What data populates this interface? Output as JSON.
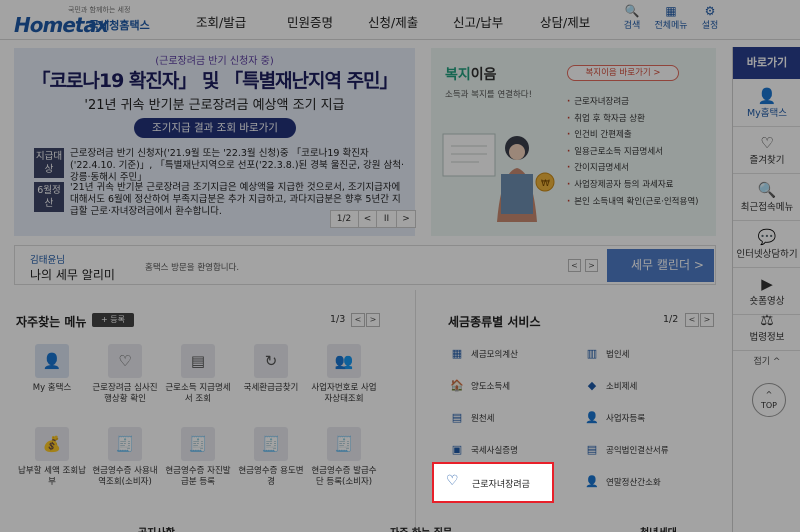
{
  "header": {
    "logo_small": "국민과 함께하는 세정",
    "logo_main": "Hometax",
    "logo_sub": "국세청홈택스",
    "nav": [
      "조회/발급",
      "민원증명",
      "신청/제출",
      "신고/납부",
      "상담/제보"
    ],
    "icons": [
      {
        "label": "검색",
        "glyph": "🔍",
        "icon": "search-icon"
      },
      {
        "label": "전체메뉴",
        "glyph": "▦",
        "icon": "grid-icon"
      },
      {
        "label": "설정",
        "glyph": "⚙",
        "icon": "gear-icon"
      }
    ]
  },
  "banner": {
    "top_note": "(근로장려금 반기 신청자 중)",
    "title": "「코로나19 확진자」 및 「특별재난지역 주민」",
    "subtitle": "'21년 귀속 반기분 근로장려금 예상액 조기 지급",
    "button": "조기지급 결과 조회 바로가기",
    "rows": [
      {
        "tag": "지급대상",
        "text": "근로장려금 반기 신청자('21.9월 또는 '22.3월 신청)중 「코로나19 확진자('22.4.10. 기준)」, 「특별재난지역으로 선포('22.3.8.)된 경북 울진군, 강원 삼척·강릉·동해시 주민」"
      },
      {
        "tag": "6월정산",
        "text": "'21년 귀속 반기분 근로장려금 조기지급은 예상액을 지급한 것으로서, 조기지급자에 대해서도 6월에 정산하여 부족지급분은 추가 지급하고, 과다지급분은 향후 5년간 지급할 근로·자녀장려금에서 환수합니다."
      }
    ],
    "pager": {
      "current": "1/2",
      "prev": "<",
      "pause": "II",
      "next": ">"
    }
  },
  "welfare": {
    "title_accent": "복지",
    "title_rest": "이음",
    "desc": "소득과 복지를 연결하다!",
    "button": "복지이음 바로가기 >",
    "items": [
      "근로자녀장려금",
      "취업 후 학자금 상환",
      "인건비 간편제출",
      "일용근로소득 지급명세서",
      "간이지급명세서",
      "사업장제공자 등의 과세자료",
      "본인 소득내역 확인(근로·인적용역)"
    ]
  },
  "sidebar": {
    "title": "바로가기",
    "items": [
      {
        "label": "My홈택스",
        "glyph": "👤",
        "icon": "user-icon"
      },
      {
        "label": "즐겨찾기",
        "glyph": "♡",
        "icon": "heart-icon"
      },
      {
        "label": "최근접속메뉴",
        "glyph": "🔍",
        "icon": "recent-search-icon"
      },
      {
        "label": "인터넷상담하기",
        "glyph": "💬",
        "icon": "chat-icon"
      },
      {
        "label": "숏폼영상",
        "glyph": "▶",
        "icon": "play-icon"
      },
      {
        "label": "법령정보",
        "glyph": "⚖",
        "icon": "gavel-icon"
      }
    ],
    "fold": "접기 ^",
    "top_arrow": "^",
    "top": "TOP"
  },
  "notice": {
    "name": "김태윤님",
    "title": "나의 세무 알리미",
    "message": "홈택스 방문을 환영합니다.",
    "prev": "<",
    "next": ">",
    "calendar": "세무 캘린더 >"
  },
  "favorites": {
    "title": "자주찾는 메뉴",
    "add": "+ 등록",
    "page": "1/3",
    "prev": "<",
    "next": ">",
    "items": [
      {
        "label": "My 홈택스",
        "glyph": "👤",
        "icon": "user-icon"
      },
      {
        "label": "근로장려금 심사진행상황 확인",
        "glyph": "♡",
        "icon": "heart-search-icon"
      },
      {
        "label": "근로소득 지급명세서 조회",
        "glyph": "▤",
        "icon": "document-icon"
      },
      {
        "label": "국세환급금찾기",
        "glyph": "↻",
        "icon": "refund-icon"
      },
      {
        "label": "사업자번호로 사업자상태조회",
        "glyph": "👥",
        "icon": "users-icon"
      },
      {
        "label": "납부할 세액 조회납부",
        "glyph": "💰",
        "icon": "money-bag-icon"
      },
      {
        "label": "현금영수증 사용내역조회(소비자)",
        "glyph": "🧾",
        "icon": "receipt-icon"
      },
      {
        "label": "현금영수증 자진발급분 등록",
        "glyph": "🧾",
        "icon": "receipt-icon"
      },
      {
        "label": "현금영수증 용도변경",
        "glyph": "🧾",
        "icon": "receipt-icon"
      },
      {
        "label": "현금영수증 발급수단 등록(소비자)",
        "glyph": "🧾",
        "icon": "receipt-icon"
      }
    ]
  },
  "taxtype": {
    "title": "세금종류별 서비스",
    "page": "1/2",
    "prev": "<",
    "next": ">",
    "left": [
      {
        "label": "세금모의계산",
        "glyph": "▦",
        "icon": "calculator-icon"
      },
      {
        "label": "양도소득세",
        "glyph": "🏠",
        "icon": "house-icon"
      },
      {
        "label": "원천세",
        "glyph": "▤",
        "icon": "document-icon"
      },
      {
        "label": "국세사실증명",
        "glyph": "▣",
        "icon": "certificate-icon"
      }
    ],
    "right": [
      {
        "label": "법인세",
        "glyph": "▥",
        "icon": "building-icon"
      },
      {
        "label": "소비제세",
        "glyph": "◆",
        "icon": "diamond-icon"
      },
      {
        "label": "사업자등록",
        "glyph": "👤",
        "icon": "person-icon"
      },
      {
        "label": "공익법인결산서류",
        "glyph": "▤",
        "icon": "clipboard-icon"
      },
      {
        "label": "연말정산간소화",
        "glyph": "👤",
        "icon": "person-icon"
      }
    ],
    "highlighted": {
      "label": "근로자녀장려금",
      "glyph": "♡",
      "icon": "heart-icon"
    }
  },
  "bottom_peek": [
    "공지사항",
    "자주 하는 질문",
    "청년세대"
  ]
}
